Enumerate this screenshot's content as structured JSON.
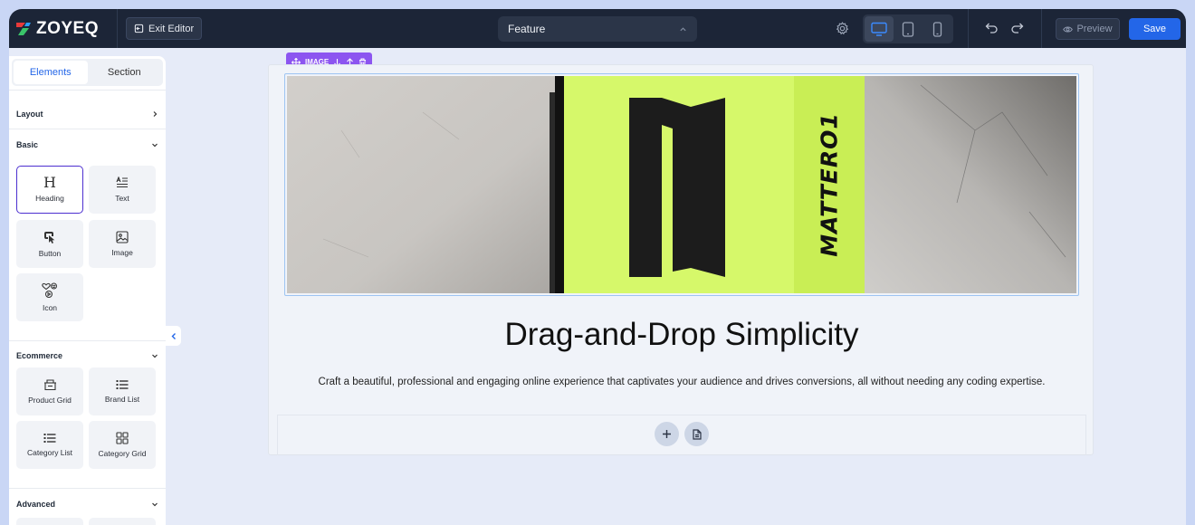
{
  "topbar": {
    "logo_text": "ZOYEQ",
    "exit_label": "Exit Editor",
    "page_select": "Feature",
    "preview_label": "Preview",
    "save_label": "Save"
  },
  "sidebar": {
    "tabs": [
      {
        "label": "Elements",
        "active": true
      },
      {
        "label": "Section",
        "active": false
      }
    ],
    "sections": {
      "layout": "Layout",
      "basic": "Basic",
      "ecommerce": "Ecommerce",
      "advanced": "Advanced"
    },
    "basic_items": [
      {
        "label": "Heading",
        "icon": "heading-icon"
      },
      {
        "label": "Text",
        "icon": "text-icon"
      },
      {
        "label": "Button",
        "icon": "button-icon"
      },
      {
        "label": "Image",
        "icon": "image-icon"
      },
      {
        "label": "Icon",
        "icon": "icon-icon"
      }
    ],
    "ecommerce_items": [
      {
        "label": "Product Grid",
        "icon": "product-grid-icon"
      },
      {
        "label": "Brand List",
        "icon": "brand-list-icon"
      },
      {
        "label": "Category List",
        "icon": "category-list-icon"
      },
      {
        "label": "Category Grid",
        "icon": "category-grid-icon"
      }
    ]
  },
  "canvas": {
    "image_toolbar_label": "IMAGE",
    "image_brand_text": "MATTERO1",
    "headline": "Drag-and-Drop Simplicity",
    "subtext": "Craft a beautiful, professional and engaging online experience that captivates your audience and drives conversions, all without needing any coding expertise."
  },
  "colors": {
    "accent": "#2366e8",
    "selection": "#8c55f0",
    "lime": "#d6f86a",
    "topbar": "#1c2537"
  }
}
